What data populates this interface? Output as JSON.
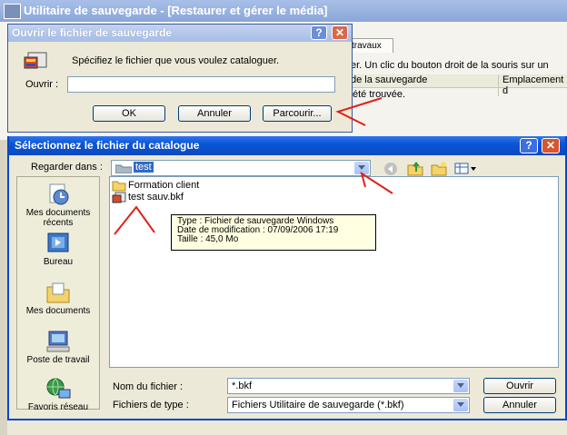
{
  "background_window": {
    "title": "Utilitaire de sauvegarde - [Restaurer et gérer le média]",
    "tab_label": "travaux",
    "info_text": "er. Un clic du bouton droit de la souris sur un",
    "col_backup": "de la sauvegarde",
    "col_location": "Emplacement d",
    "row_text": "été trouvée."
  },
  "open_dialog": {
    "title": "Ouvrir le fichier de sauvegarde",
    "instruction": "Spécifiez le fichier que vous voulez cataloguer.",
    "open_label": "Ouvrir :",
    "open_value": "",
    "ok_label": "OK",
    "cancel_label": "Annuler",
    "browse_label": "Parcourir..."
  },
  "select_dialog": {
    "title": "Sélectionnez le fichier du catalogue",
    "look_in_label": "Regarder dans :",
    "look_in_value": "test",
    "places": [
      {
        "label": "Mes documents récents",
        "icon": "recent-documents-icon"
      },
      {
        "label": "Bureau",
        "icon": "desktop-icon"
      },
      {
        "label": "Mes documents",
        "icon": "my-documents-icon"
      },
      {
        "label": "Poste de travail",
        "icon": "my-computer-icon"
      },
      {
        "label": "Favoris réseau",
        "icon": "network-places-icon"
      }
    ],
    "files": [
      {
        "name": "Formation client",
        "icon": "folder-icon"
      },
      {
        "name": "test sauv.bkf",
        "icon": "backup-file-icon"
      }
    ],
    "tooltip": {
      "type_line": "Type : Fichier de sauvegarde Windows",
      "date_line": "Date de modification : 07/09/2006 17:19",
      "size_line": "Taille  : 45,0 Mo"
    },
    "filename_label": "Nom du fichier :",
    "filename_value": "*.bkf",
    "filetype_label": "Fichiers de type :",
    "filetype_value": "Fichiers Utilitaire de sauvegarde (*.bkf)",
    "open_button": "Ouvrir",
    "cancel_button": "Annuler"
  },
  "colors": {
    "annotation_red": "#e0201a",
    "xp_blue": "#0b55d6"
  }
}
